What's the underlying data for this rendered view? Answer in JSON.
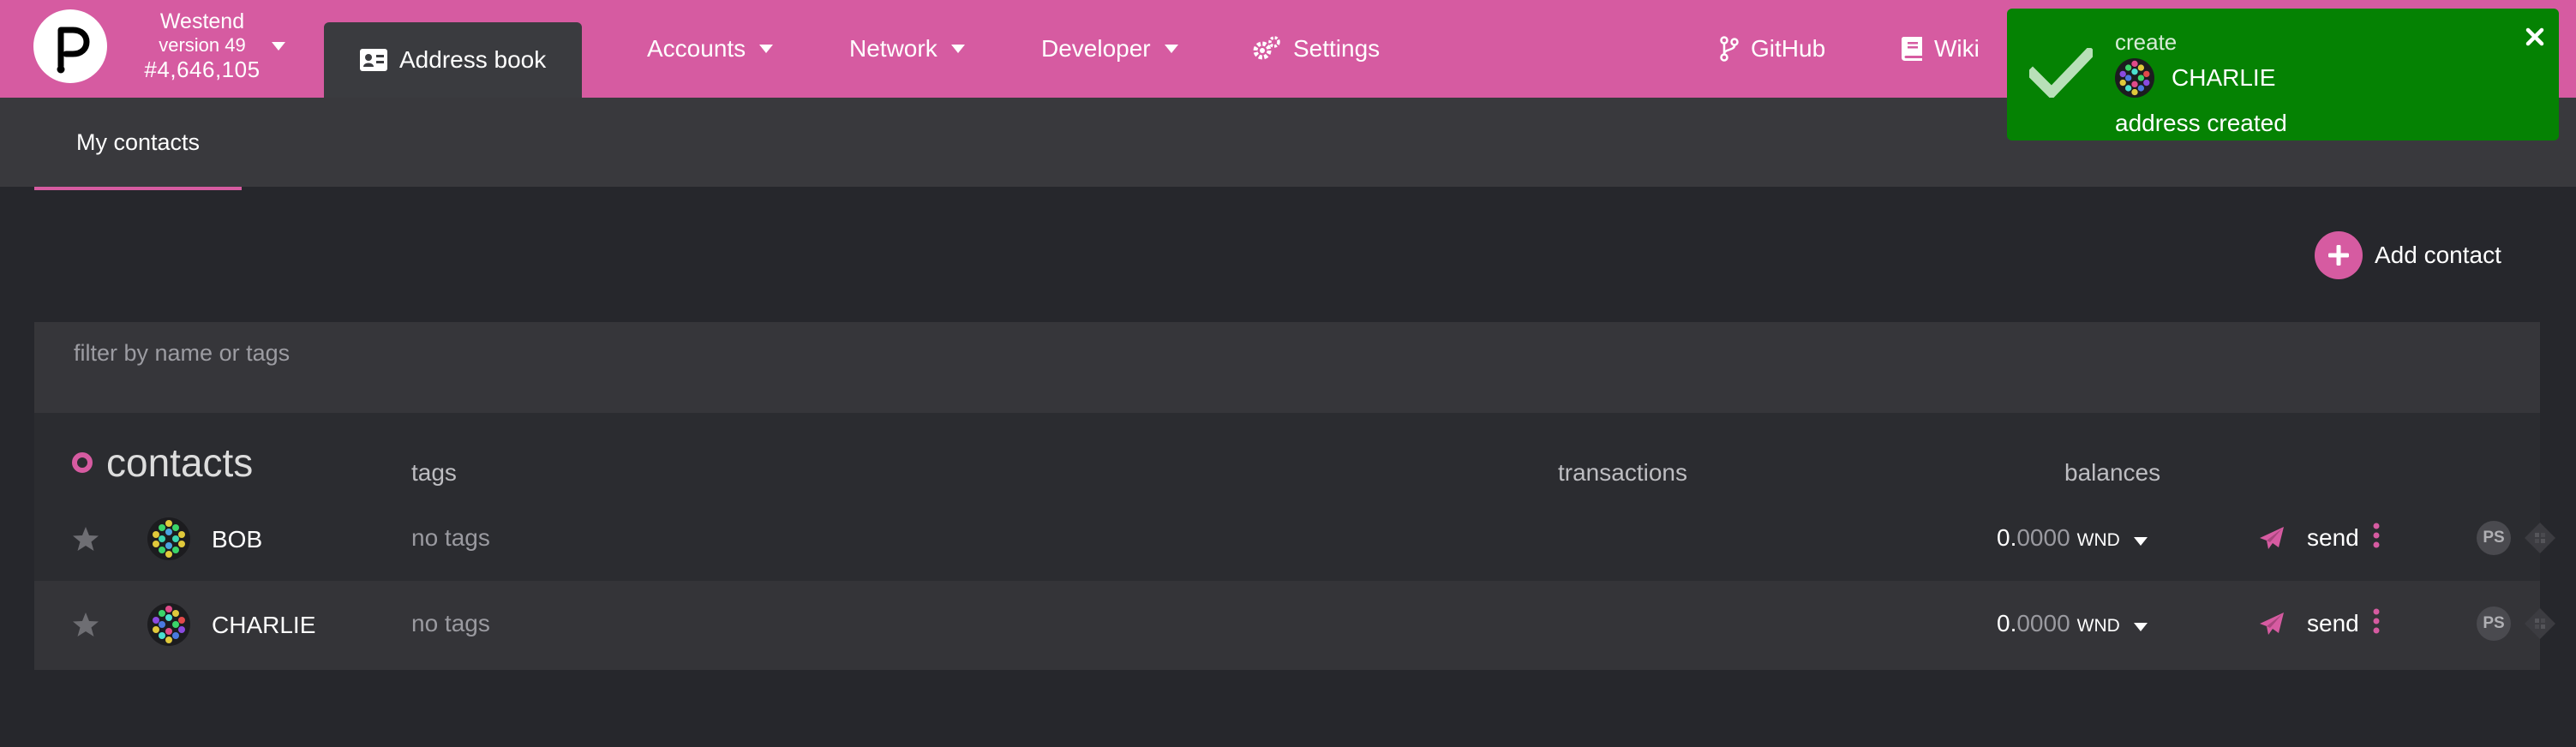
{
  "colors": {
    "accent": "#d65ba1",
    "toast_success": "#058203",
    "background": "#26272c"
  },
  "chain": {
    "name": "Westend",
    "version": "version 49",
    "block": "#4,646,105"
  },
  "nav": {
    "address_book": "Address book",
    "accounts": "Accounts",
    "network": "Network",
    "developer": "Developer",
    "settings": "Settings",
    "github": "GitHub",
    "wiki": "Wiki"
  },
  "subnav": {
    "my_contacts": "My contacts"
  },
  "add_contact": {
    "label": "Add contact"
  },
  "filter": {
    "placeholder": "filter by name or tags",
    "value": ""
  },
  "table": {
    "title": "contacts",
    "col_tags": "tags",
    "col_transactions": "transactions",
    "col_balances": "balances",
    "rows": [
      {
        "name": "BOB",
        "tags": "no tags",
        "balance_int": "0.",
        "balance_dec": "0000",
        "unit": "WND",
        "send": "send",
        "ps": "PS"
      },
      {
        "name": "CHARLIE",
        "tags": "no tags",
        "balance_int": "0.",
        "balance_dec": "0000",
        "unit": "WND",
        "send": "send",
        "ps": "PS"
      }
    ]
  },
  "toast": {
    "action": "create",
    "name": "CHARLIE",
    "message": "address created"
  },
  "icons": [
    "polkadot-logo-icon",
    "address-card-icon",
    "caret-down-icon",
    "cogs-icon",
    "code-branch-icon",
    "book-icon",
    "plus-icon",
    "star-icon",
    "identicon-icon",
    "paper-plane-icon",
    "ellipsis-vertical-icon",
    "qr-icon",
    "check-icon",
    "close-icon"
  ]
}
